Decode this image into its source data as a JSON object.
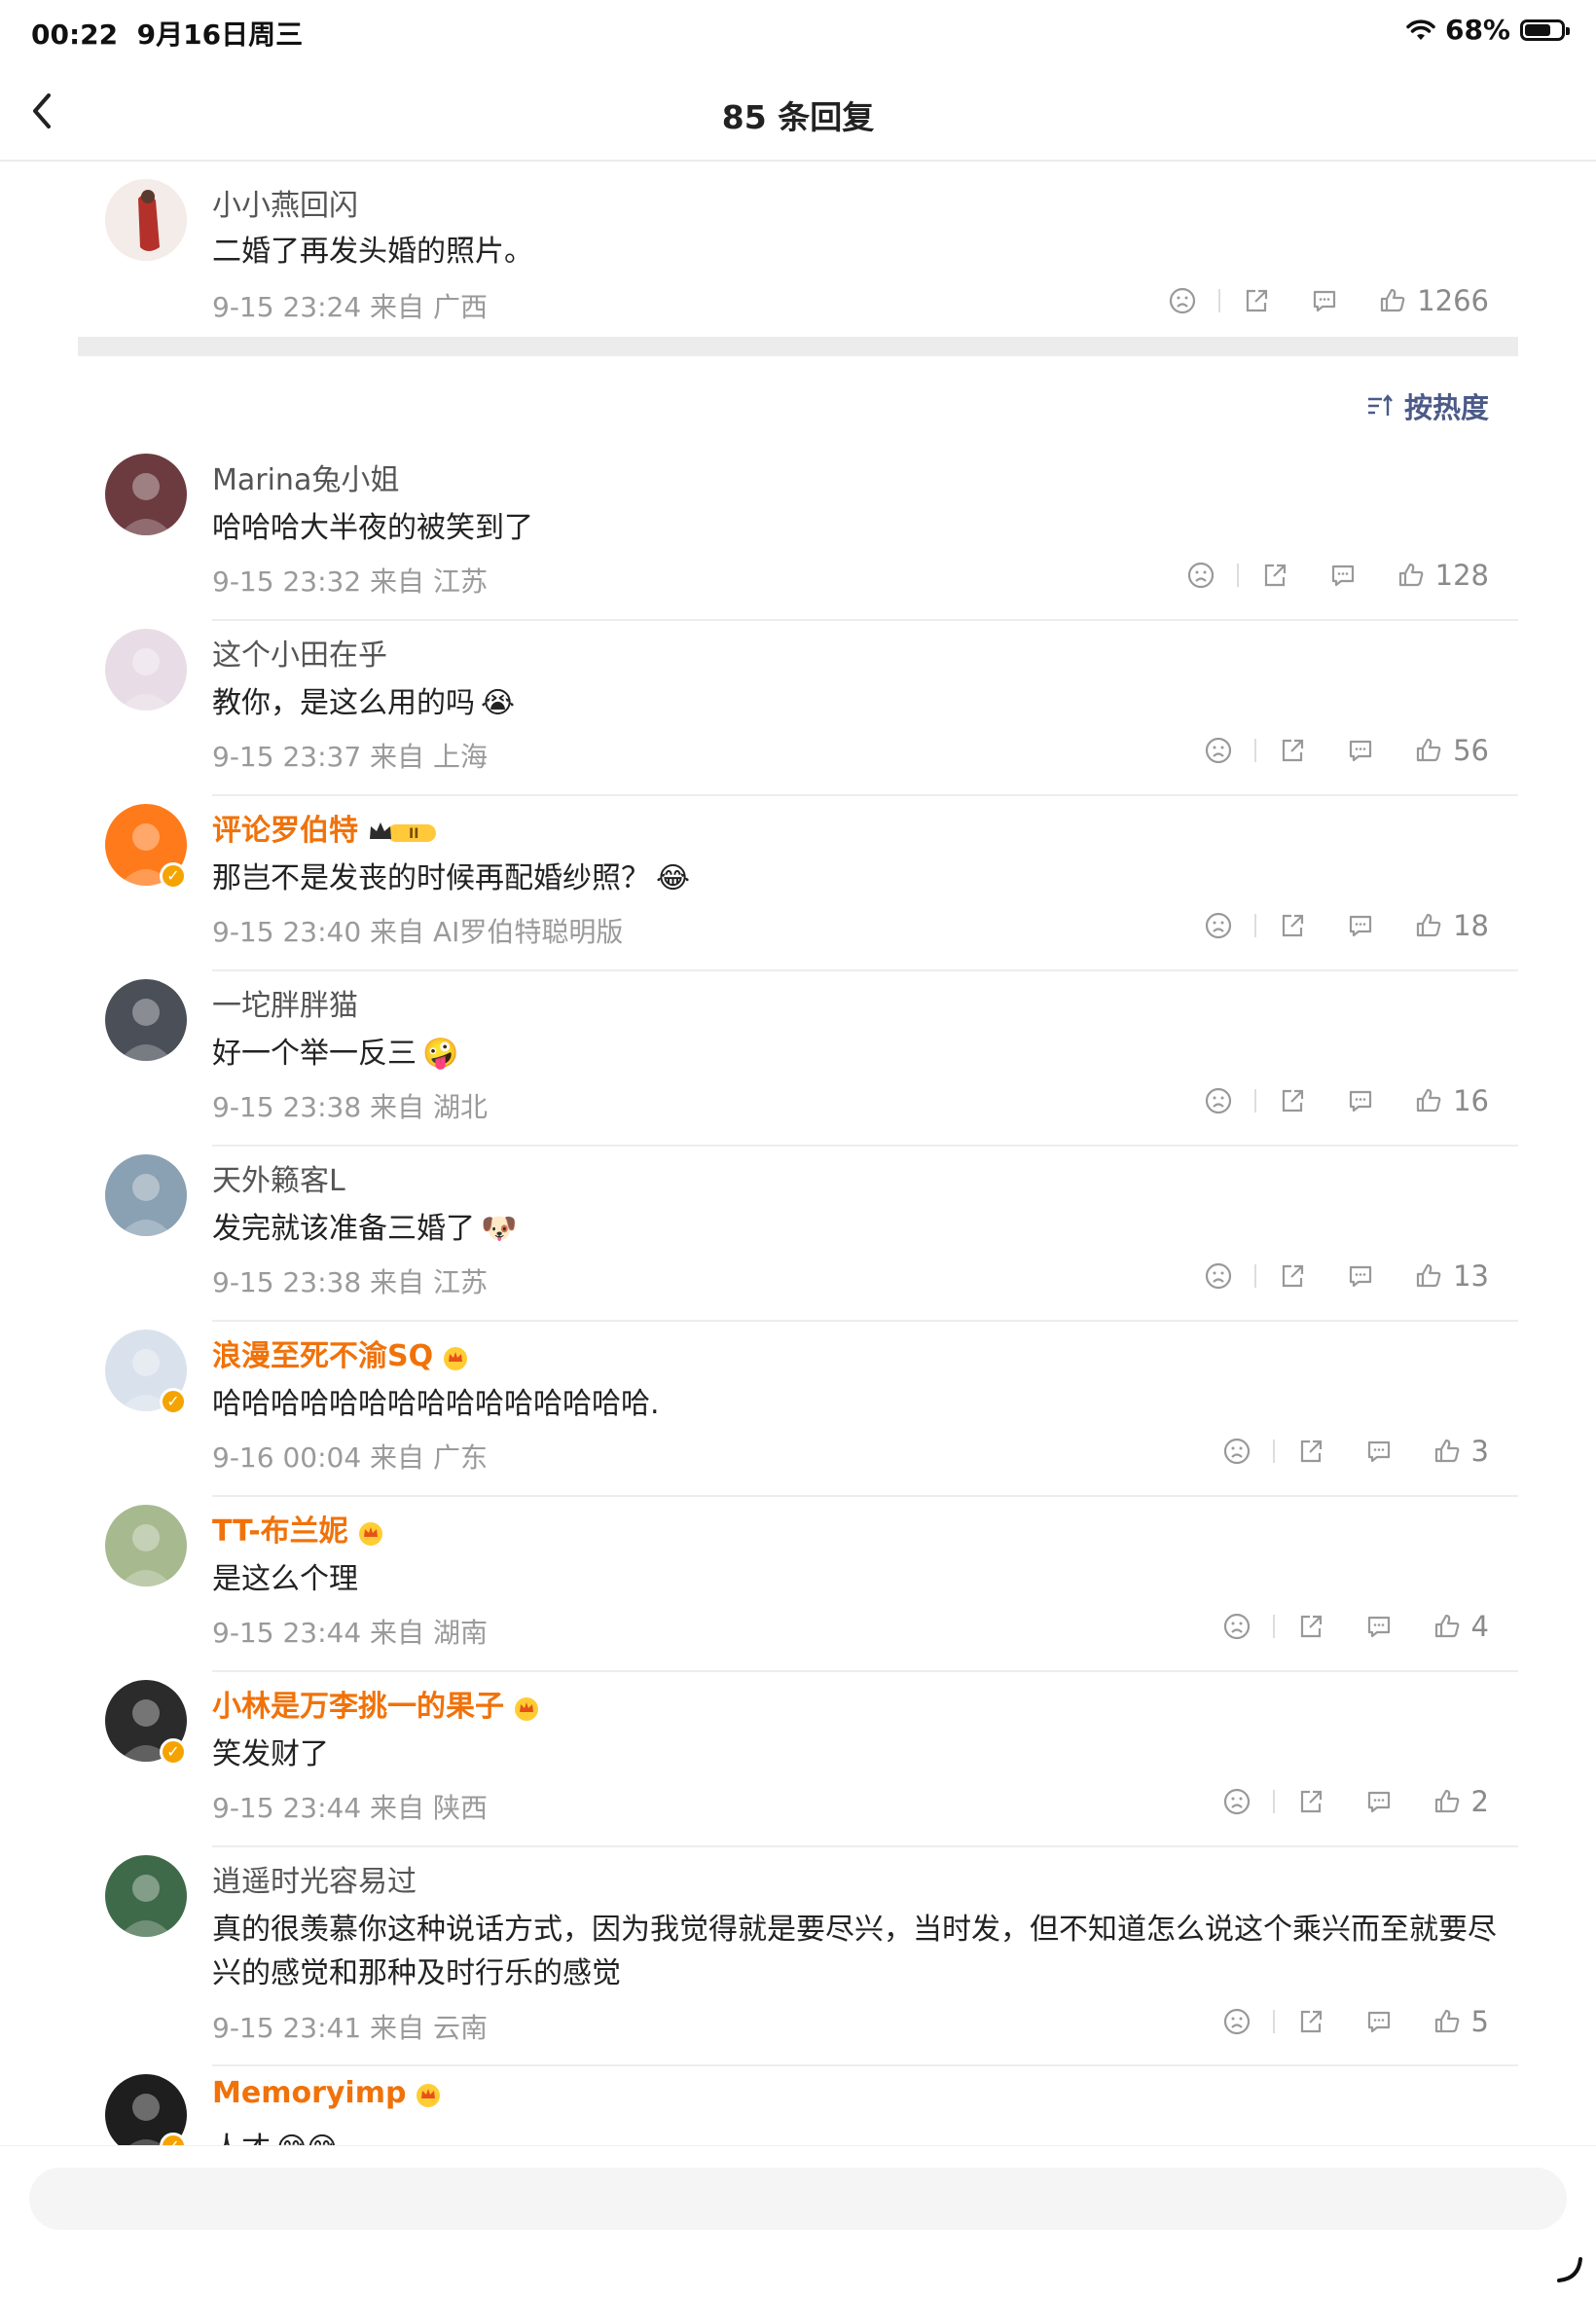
{
  "status": {
    "time": "00:22",
    "date": "9月16日周三",
    "battery": "68%",
    "battery_level": 0.68
  },
  "nav": {
    "title": "85 条回复"
  },
  "root": {
    "name": "小小燕回闪",
    "text": "二婚了再发头婚的照片。",
    "meta": "9-15 23:24 来自 广西",
    "likes": "1266"
  },
  "sort": {
    "label": "按热度"
  },
  "comments": [
    {
      "name": "Marina兔小姐",
      "text": "哈哈哈大半夜的被笑到了",
      "meta": "9-15 23:32 来自 江苏",
      "likes": "128"
    },
    {
      "name": "这个小田在乎",
      "text": "教你，是这么用的吗",
      "emoji": "😭",
      "meta": "9-15 23:37 来自 上海",
      "likes": "56"
    },
    {
      "name": "评论罗伯特",
      "text": "那岂不是发丧的时候再配婚纱照？",
      "emoji": "😂",
      "meta": "9-15 23:40 来自 AI罗伯特聪明版",
      "likes": "18"
    },
    {
      "name": "一坨胖胖猫",
      "text": "好一个举一反三",
      "emoji": "🤪",
      "meta": "9-15 23:38 来自 湖北",
      "likes": "16"
    },
    {
      "name": "天外籁客L",
      "text": "发完就该准备三婚了",
      "emoji": "🐶",
      "meta": "9-15 23:38 来自 江苏",
      "likes": "13"
    },
    {
      "name": "浪漫至死不渝SQ",
      "text": "哈哈哈哈哈哈哈哈哈哈哈哈哈哈哈.",
      "meta": "9-16 00:04 来自 广东",
      "likes": "3"
    },
    {
      "name": "TT-布兰妮",
      "text": "是这么个理",
      "meta": "9-15 23:44 来自 湖南",
      "likes": "4"
    },
    {
      "name": "小林是万李挑一的果子",
      "text": "笑发财了",
      "meta": "9-15 23:44 来自 陕西",
      "likes": "2"
    },
    {
      "name": "逍遥时光容易过",
      "text": "真的很羡慕你这种说话方式，因为我觉得就是要尽兴，当时发，但不知道怎么说这个乘兴而至就要尽兴的感觉和那种及时行乐的感觉",
      "meta": "9-15 23:41 来自 云南",
      "likes": "5"
    },
    {
      "name": "Memoryimp",
      "text": "人才",
      "emoji": "😅😅",
      "meta": "",
      "likes": ""
    }
  ],
  "colors": {
    "vip_name": "#f0720a",
    "normal_name": "#555555",
    "sort": "#4b5a88",
    "divider": "#ececec"
  },
  "icons": [
    "back-icon",
    "wifi-icon",
    "battery-icon",
    "sad-face-icon",
    "share-icon",
    "comment-icon",
    "like-icon",
    "sort-icon",
    "crown-badge-icon",
    "verified-icon"
  ]
}
